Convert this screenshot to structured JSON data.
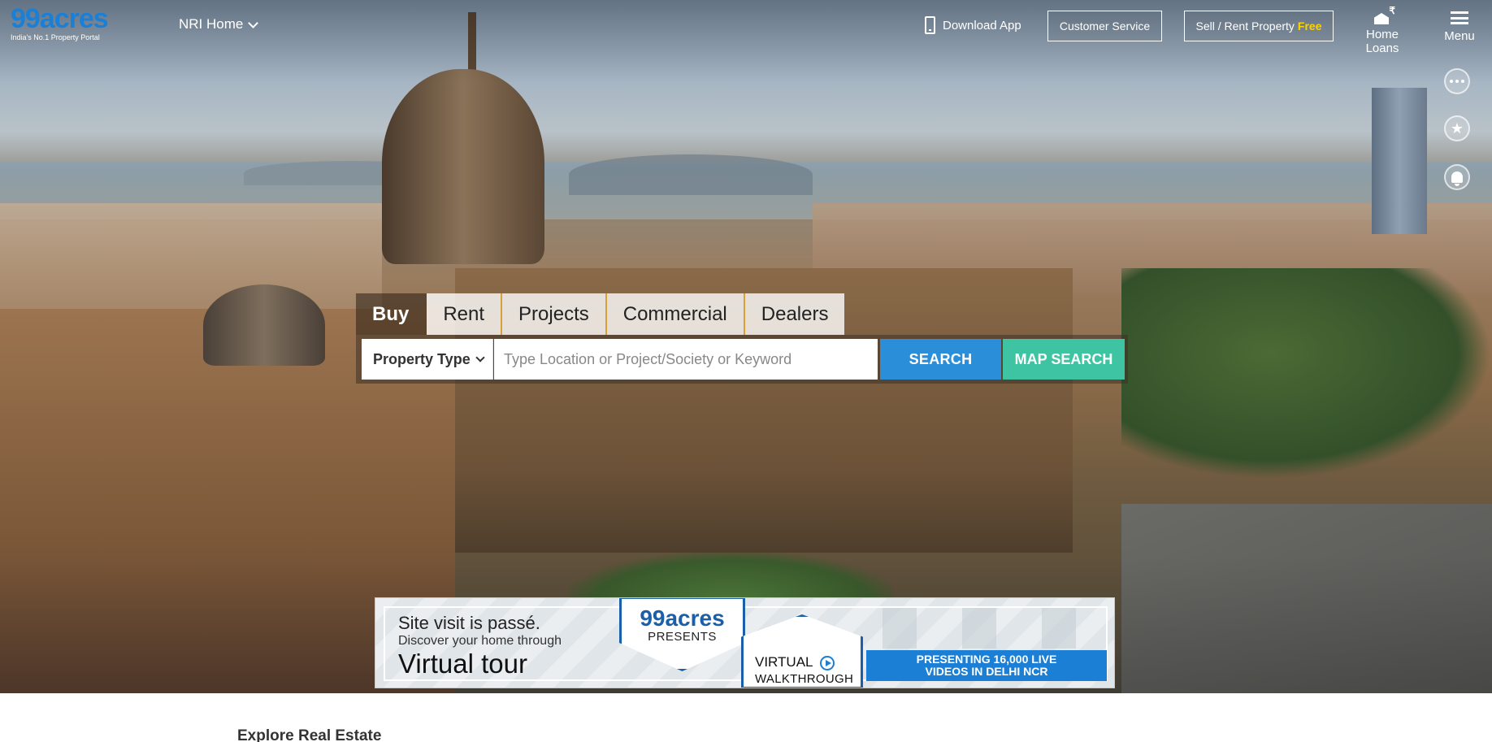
{
  "header": {
    "logo_text": "99acres",
    "logo_tagline": "India's No.1 Property Portal",
    "nri_home": "NRI Home",
    "download_app": "Download App",
    "customer_service": "Customer Service",
    "sell_rent": "Sell / Rent Property",
    "sell_free": "Free",
    "home_loans": "Home Loans",
    "menu": "Menu"
  },
  "search": {
    "tabs": [
      "Buy",
      "Rent",
      "Projects",
      "Commercial",
      "Dealers"
    ],
    "active_tab": "Buy",
    "property_type": "Property Type",
    "placeholder": "Type Location or Project/Society or Keyword",
    "search_button": "SEARCH",
    "map_search_button": "MAP SEARCH"
  },
  "banner": {
    "line1": "Site visit is passé.",
    "line2": "Discover your home through",
    "line3": "Virtual tour",
    "brand": "99acres",
    "presents": "PRESENTS",
    "virtual": "VIRTUAL",
    "walkthrough": "WALKTHROUGH",
    "promo_line1": "PRESENTING 16,000 LIVE",
    "promo_line2": "VIDEOS IN DELHI NCR"
  },
  "section": {
    "explore_title": "Explore Real Estate"
  },
  "side_icons": [
    "more-icon",
    "star-icon",
    "bell-icon"
  ],
  "colors": {
    "brand_blue": "#1b7fd6",
    "search_blue": "#2b8ed8",
    "map_green": "#3ec4a2",
    "free_yellow": "#ffd200"
  }
}
